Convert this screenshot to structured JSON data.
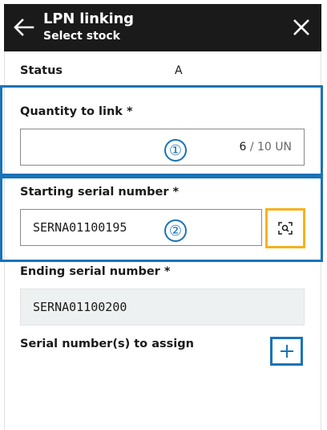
{
  "header": {
    "title": "LPN linking",
    "subtitle": "Select stock",
    "back_icon": "arrow-left-icon",
    "close_icon": "close-icon"
  },
  "status": {
    "label": "Status",
    "value": "A"
  },
  "quantity": {
    "label": "Quantity to link *",
    "value": "6",
    "total": "/ 10 UN",
    "marker": "①"
  },
  "starting_serial": {
    "label": "Starting serial number *",
    "value": "SERNA01100195",
    "marker": "②",
    "scan_icon": "scan-search-icon"
  },
  "ending_serial": {
    "label": "Ending serial number *",
    "value": "SERNA01100200"
  },
  "assign": {
    "label": "Serial number(s) to assign",
    "add_icon": "plus-icon"
  },
  "colors": {
    "header_bg": "#1a1a1a",
    "highlight_blue": "#1a73b8",
    "highlight_yellow": "#f5b21a",
    "readonly_bg": "#eef1f1"
  }
}
